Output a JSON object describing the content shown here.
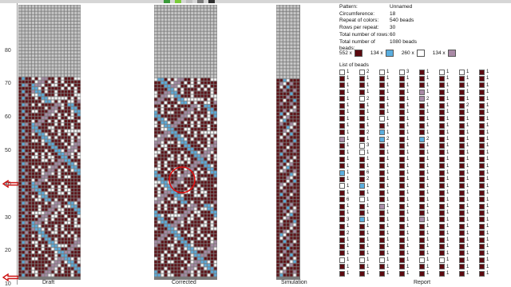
{
  "colors": {
    "maroon": "#5c0a10",
    "blue": "#5aaee0",
    "white": "#ffffff",
    "mauve": "#a98aa6",
    "grid_line": "#7a7a7a",
    "empty": "#cfcfcf"
  },
  "topbar_swatches": [
    "#3a9a3a",
    "#7acc3a",
    "#c0c0c0",
    "#7a7a7a",
    "#303030"
  ],
  "ruler": {
    "labels": [
      "80",
      "70",
      "60",
      "50",
      "40",
      "30",
      "20",
      "10"
    ],
    "markers": [
      "left-arrow-icon",
      "left-arrow-icon"
    ]
  },
  "captions": {
    "draft": "Draft",
    "corrected": "Corrected",
    "simulation": "Simulation",
    "report": "Report"
  },
  "info": [
    {
      "k": "Pattern:",
      "v": "Unnamed"
    },
    {
      "k": "Circumference:",
      "v": "18"
    },
    {
      "k": "Repeat of colors:",
      "v": "540 beads"
    },
    {
      "k": "Rows per repeat:",
      "v": "30"
    },
    {
      "k": "Total number of rows:",
      "v": "60"
    },
    {
      "k": "Total number of beads:",
      "v": "1080 beads"
    }
  ],
  "legend": [
    {
      "count": "552 x",
      "color": "maroon"
    },
    {
      "count": "134 x",
      "color": "blue"
    },
    {
      "count": "260 x",
      "color": "white"
    },
    {
      "count": "134 x",
      "color": "mauve"
    }
  ],
  "list_title": "List of beads",
  "bead_list": {
    "rows": 31,
    "columns": [
      {
        "colors": [
          "white",
          "maroon",
          "maroon",
          "maroon",
          "maroon",
          "maroon",
          "maroon",
          "maroon",
          "maroon",
          "maroon",
          "mauve",
          "maroon",
          "maroon",
          "maroon",
          "maroon",
          "blue",
          "maroon",
          "white",
          "maroon",
          "maroon",
          "maroon",
          "maroon",
          "maroon",
          "maroon",
          "maroon",
          "maroon",
          "maroon",
          "maroon",
          "white",
          "maroon",
          "maroon"
        ],
        "counts": [
          "1",
          "1",
          "1",
          "1",
          "1",
          "1",
          "1",
          "1",
          "1",
          "1",
          "1",
          "1",
          "1",
          "1",
          "1",
          "1",
          "1",
          "1",
          "1",
          "6",
          "1",
          "1",
          "3",
          "1",
          "2",
          "1",
          "1",
          "1",
          "1",
          "1",
          "1"
        ]
      },
      {
        "colors": [
          "white",
          "maroon",
          "maroon",
          "maroon",
          "white",
          "maroon",
          "maroon",
          "maroon",
          "maroon",
          "maroon",
          "maroon",
          "white",
          "white",
          "maroon",
          "maroon",
          "maroon",
          "maroon",
          "blue",
          "maroon",
          "white",
          "maroon",
          "maroon",
          "blue",
          "maroon",
          "maroon",
          "maroon",
          "maroon",
          "maroon",
          "white",
          "maroon",
          "maroon"
        ],
        "counts": [
          "2",
          "1",
          "1",
          "1",
          "2",
          "1",
          "1",
          "1",
          "1",
          "2",
          "1",
          "3",
          "1",
          "1",
          "1",
          "6",
          "2",
          "1",
          "1",
          "1",
          "1",
          "1",
          "1",
          "1",
          "1",
          "1",
          "1",
          "1",
          "1",
          "1",
          "1"
        ]
      },
      {
        "colors": [
          "white",
          "maroon",
          "maroon",
          "maroon",
          "maroon",
          "maroon",
          "maroon",
          "white",
          "maroon",
          "blue",
          "blue",
          "maroon",
          "maroon",
          "maroon",
          "maroon",
          "maroon",
          "maroon",
          "maroon",
          "maroon",
          "maroon",
          "mauve",
          "maroon",
          "maroon",
          "maroon",
          "maroon",
          "maroon",
          "maroon",
          "maroon",
          "white",
          "maroon",
          "maroon"
        ],
        "counts": [
          "1",
          "1",
          "1",
          "1",
          "1",
          "1",
          "1",
          "1",
          "1",
          "1",
          "2",
          "1",
          "1",
          "1",
          "1",
          "1",
          "1",
          "1",
          "1",
          "1",
          "1",
          "1",
          "1",
          "1",
          "1",
          "1",
          "1",
          "1",
          "1",
          "1",
          "1"
        ]
      },
      {
        "colors": [
          "white",
          "maroon",
          "maroon",
          "maroon",
          "maroon",
          "maroon",
          "maroon",
          "maroon",
          "maroon",
          "maroon",
          "maroon",
          "maroon",
          "maroon",
          "maroon",
          "maroon",
          "maroon",
          "maroon",
          "maroon",
          "maroon",
          "maroon",
          "maroon",
          "maroon",
          "maroon",
          "maroon",
          "maroon",
          "maroon",
          "maroon",
          "maroon",
          "maroon",
          "maroon",
          "maroon"
        ],
        "counts": [
          "3",
          "1",
          "1",
          "1",
          "1",
          "1",
          "1",
          "1",
          "1",
          "1",
          "1",
          "1",
          "1",
          "1",
          "1",
          "1",
          "1",
          "1",
          "1",
          "1",
          "1",
          "1",
          "1",
          "1",
          "1",
          "1",
          "1",
          "1",
          "1",
          "1",
          "1"
        ]
      },
      {
        "colors": [
          "maroon",
          "maroon",
          "maroon",
          "mauve",
          "mauve",
          "maroon",
          "maroon",
          "maroon",
          "maroon",
          "maroon",
          "blue",
          "maroon",
          "maroon",
          "maroon",
          "maroon",
          "maroon",
          "maroon",
          "maroon",
          "maroon",
          "maroon",
          "maroon",
          "maroon",
          "mauve",
          "maroon",
          "maroon",
          "maroon",
          "maroon",
          "maroon",
          "white",
          "maroon",
          "maroon"
        ],
        "counts": [
          "1",
          "1",
          "1",
          "1",
          "2",
          "1",
          "1",
          "1",
          "1",
          "1",
          "2",
          "1",
          "1",
          "1",
          "1",
          "1",
          "1",
          "1",
          "1",
          "1",
          "1",
          "1",
          "1",
          "1",
          "1",
          "1",
          "1",
          "1",
          "1",
          "1",
          "1"
        ]
      },
      {
        "colors": [
          "white",
          "maroon",
          "maroon",
          "maroon",
          "maroon",
          "maroon",
          "maroon",
          "maroon",
          "maroon",
          "maroon",
          "maroon",
          "maroon",
          "maroon",
          "maroon",
          "maroon",
          "maroon",
          "maroon",
          "maroon",
          "maroon",
          "maroon",
          "maroon",
          "maroon",
          "maroon",
          "maroon",
          "maroon",
          "maroon",
          "maroon",
          "maroon",
          "white",
          "maroon",
          "maroon"
        ],
        "counts": [
          "1",
          "1",
          "1",
          "1",
          "1",
          "1",
          "1",
          "1",
          "1",
          "1",
          "1",
          "1",
          "1",
          "1",
          "1",
          "1",
          "1",
          "1",
          "1",
          "1",
          "1",
          "1",
          "1",
          "1",
          "1",
          "1",
          "1",
          "1",
          "1",
          "1",
          "1"
        ]
      },
      {
        "colors": [
          "white",
          "maroon",
          "maroon",
          "maroon",
          "maroon",
          "maroon",
          "maroon",
          "maroon",
          "maroon",
          "maroon",
          "maroon",
          "maroon",
          "maroon",
          "maroon",
          "maroon",
          "maroon",
          "maroon",
          "maroon",
          "maroon",
          "maroon",
          "maroon",
          "maroon",
          "maroon",
          "maroon",
          "maroon",
          "maroon",
          "maroon",
          "maroon",
          "maroon",
          "maroon",
          "maroon"
        ],
        "counts": [
          "1",
          "1",
          "1",
          "1",
          "1",
          "2",
          "1",
          "1",
          "1",
          "1",
          "1",
          "1",
          "1",
          "1",
          "1",
          "1",
          "1",
          "1",
          "1",
          "1",
          "1",
          "1",
          "1",
          "1",
          "1",
          "1",
          "1",
          "1",
          "1",
          "1",
          "1"
        ]
      },
      {
        "colors": [
          "maroon",
          "maroon",
          "maroon",
          "maroon",
          "maroon",
          "maroon",
          "maroon",
          "maroon",
          "maroon",
          "maroon",
          "maroon",
          "maroon",
          "maroon",
          "maroon",
          "maroon",
          "maroon",
          "maroon",
          "maroon",
          "maroon",
          "maroon",
          "maroon",
          "maroon",
          "maroon",
          "maroon",
          "maroon",
          "maroon",
          "maroon",
          "maroon",
          "maroon",
          "maroon",
          "maroon"
        ],
        "counts": [
          "1",
          "1",
          "1",
          "1",
          "1",
          "1",
          "1",
          "1",
          "1",
          "1",
          "1",
          "1",
          "1",
          "1",
          "1",
          "1",
          "1",
          "1",
          "1",
          "1",
          "1",
          "1",
          "1",
          "1",
          "1",
          "1",
          "1",
          "1",
          "1",
          "1",
          "1"
        ]
      }
    ]
  }
}
